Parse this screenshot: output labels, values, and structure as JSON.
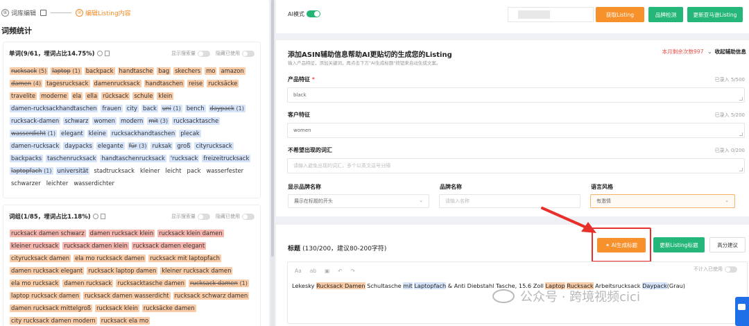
{
  "steps": {
    "step1_num": "①",
    "step1": "词库编辑",
    "step2_num": "②",
    "step2": "编辑Listing内容"
  },
  "section_title": "词频统计",
  "words_card": {
    "title": "单词(9/61，埋词占比14.75%)",
    "opt_search": "显示搜索量",
    "opt_hide": "隐藏已使用",
    "tags": [
      {
        "w": "rucksack",
        "c": "(5)",
        "t": "o",
        "s": true
      },
      {
        "w": "laptop",
        "c": "(1)",
        "t": "o",
        "s": true
      },
      {
        "w": "backpack",
        "c": "",
        "t": "o",
        "s": false
      },
      {
        "w": "handtasche",
        "c": "",
        "t": "o",
        "s": false
      },
      {
        "w": "bag",
        "c": "",
        "t": "o",
        "s": false
      },
      {
        "w": "skechers",
        "c": "",
        "t": "o",
        "s": false
      },
      {
        "w": "mo",
        "c": "",
        "t": "o",
        "s": false
      },
      {
        "w": "amazon",
        "c": "",
        "t": "o",
        "s": false
      },
      {
        "w": "damen",
        "c": "(4)",
        "t": "o",
        "s": true
      },
      {
        "w": "tagesrucksack",
        "c": "",
        "t": "o",
        "s": false
      },
      {
        "w": "damenrucksack",
        "c": "",
        "t": "o",
        "s": false
      },
      {
        "w": "handtaschen",
        "c": "",
        "t": "o",
        "s": false
      },
      {
        "w": "reise",
        "c": "",
        "t": "o",
        "s": false
      },
      {
        "w": "rucksäcke",
        "c": "",
        "t": "o",
        "s": false
      },
      {
        "w": "travelite",
        "c": "",
        "t": "o",
        "s": false
      },
      {
        "w": "moderne",
        "c": "",
        "t": "o",
        "s": false
      },
      {
        "w": "ela",
        "c": "",
        "t": "o",
        "s": false
      },
      {
        "w": "ella",
        "c": "",
        "t": "o",
        "s": false
      },
      {
        "w": "rücksack",
        "c": "",
        "t": "o",
        "s": false
      },
      {
        "w": "schule",
        "c": "",
        "t": "o",
        "s": false
      },
      {
        "w": "klein",
        "c": "",
        "t": "o",
        "s": false
      },
      {
        "w": "damen-rucksackhandtaschen",
        "c": "",
        "t": "b",
        "s": false
      },
      {
        "w": "frauen",
        "c": "",
        "t": "b",
        "s": false
      },
      {
        "w": "city",
        "c": "",
        "t": "b",
        "s": false
      },
      {
        "w": "back",
        "c": "",
        "t": "b",
        "s": false
      },
      {
        "w": "uni",
        "c": "(1)",
        "t": "b",
        "s": true
      },
      {
        "w": "bench",
        "c": "",
        "t": "b",
        "s": false
      },
      {
        "w": "daypack",
        "c": "(1)",
        "t": "b",
        "s": true
      },
      {
        "w": "rucksack-damen",
        "c": "",
        "t": "b",
        "s": false
      },
      {
        "w": "schwarz",
        "c": "",
        "t": "b",
        "s": false
      },
      {
        "w": "women",
        "c": "",
        "t": "b",
        "s": false
      },
      {
        "w": "modern",
        "c": "",
        "t": "b",
        "s": false
      },
      {
        "w": "mit",
        "c": "(3)",
        "t": "b",
        "s": true
      },
      {
        "w": "rucksacktasche",
        "c": "",
        "t": "b",
        "s": false
      },
      {
        "w": "wasserdicht",
        "c": "(1)",
        "t": "b",
        "s": true
      },
      {
        "w": "elegant",
        "c": "",
        "t": "b",
        "s": false
      },
      {
        "w": "kleine",
        "c": "",
        "t": "b",
        "s": false
      },
      {
        "w": "rucksackhandtaschen",
        "c": "",
        "t": "b",
        "s": false
      },
      {
        "w": "plecak",
        "c": "",
        "t": "b",
        "s": false
      },
      {
        "w": "damen-rucksack",
        "c": "",
        "t": "b",
        "s": false
      },
      {
        "w": "daypacks",
        "c": "",
        "t": "b",
        "s": false
      },
      {
        "w": "elegante",
        "c": "",
        "t": "b",
        "s": false
      },
      {
        "w": "für",
        "c": "(3)",
        "t": "b",
        "s": true
      },
      {
        "w": "ruksak",
        "c": "",
        "t": "b",
        "s": false
      },
      {
        "w": "groß",
        "c": "",
        "t": "b",
        "s": false
      },
      {
        "w": "cityrucksack",
        "c": "",
        "t": "b",
        "s": false
      },
      {
        "w": "backpacks",
        "c": "",
        "t": "b",
        "s": false
      },
      {
        "w": "taschenrucksack",
        "c": "",
        "t": "b",
        "s": false
      },
      {
        "w": "handtaschenrucksack",
        "c": "",
        "t": "b",
        "s": false
      },
      {
        "w": "'rucksack",
        "c": "",
        "t": "b",
        "s": false
      },
      {
        "w": "freizeitrucksack",
        "c": "",
        "t": "b",
        "s": false
      },
      {
        "w": "laptopfach",
        "c": "(1)",
        "t": "b",
        "s": true
      },
      {
        "w": "universität",
        "c": "",
        "t": "b",
        "s": false
      },
      {
        "w": "stadtrucksack",
        "c": "",
        "t": "n",
        "s": false
      },
      {
        "w": "kleiner",
        "c": "",
        "t": "n",
        "s": false
      },
      {
        "w": "leicht",
        "c": "",
        "t": "n",
        "s": false
      },
      {
        "w": "pack",
        "c": "",
        "t": "n",
        "s": false
      },
      {
        "w": "wasserfester",
        "c": "",
        "t": "n",
        "s": false
      },
      {
        "w": "schwarzer",
        "c": "",
        "t": "n",
        "s": false
      },
      {
        "w": "leichter",
        "c": "",
        "t": "n",
        "s": false
      },
      {
        "w": "wasserdichter",
        "c": "",
        "t": "n",
        "s": false
      }
    ]
  },
  "phrases_card": {
    "title": "词组(1/85，埋词占比1.18%)",
    "opt_search": "显示搜索量",
    "opt_hide": "隐藏已使用",
    "tags": [
      {
        "w": "rucksack damen schwarz",
        "c": "",
        "t": "r",
        "s": false
      },
      {
        "w": "damen rucksack klein",
        "c": "",
        "t": "r",
        "s": false
      },
      {
        "w": "rucksack klein damen",
        "c": "",
        "t": "r",
        "s": false
      },
      {
        "w": "kleiner rucksack",
        "c": "",
        "t": "r",
        "s": false
      },
      {
        "w": "rucksack damen klein",
        "c": "",
        "t": "r",
        "s": false
      },
      {
        "w": "rucksack damen elegant",
        "c": "",
        "t": "r",
        "s": false
      },
      {
        "w": "cityrucksack damen",
        "c": "",
        "t": "o",
        "s": false
      },
      {
        "w": "ela mo rucksack damen",
        "c": "",
        "t": "o",
        "s": false
      },
      {
        "w": "rucksack mit laptopfach",
        "c": "",
        "t": "o",
        "s": false
      },
      {
        "w": "damen rucksack elegant",
        "c": "",
        "t": "o",
        "s": false
      },
      {
        "w": "rucksack laptop damen",
        "c": "",
        "t": "o",
        "s": false
      },
      {
        "w": "kleiner rucksack damen",
        "c": "",
        "t": "o",
        "s": false
      },
      {
        "w": "ela mo rucksack",
        "c": "",
        "t": "o",
        "s": false
      },
      {
        "w": "damen rucksack",
        "c": "",
        "t": "o",
        "s": false
      },
      {
        "w": "rucksacktasche damen",
        "c": "",
        "t": "o",
        "s": false
      },
      {
        "w": "rucksack damen",
        "c": "(1)",
        "t": "o",
        "s": true
      },
      {
        "w": "laptop rucksack damen",
        "c": "",
        "t": "o",
        "s": false
      },
      {
        "w": "rucksack damen wasserdicht",
        "c": "",
        "t": "o",
        "s": false
      },
      {
        "w": "rucksack schwarz damen",
        "c": "",
        "t": "o",
        "s": false
      },
      {
        "w": "damen rucksack mittelgroß",
        "c": "",
        "t": "o",
        "s": false
      },
      {
        "w": "rucksack klein",
        "c": "",
        "t": "o",
        "s": false
      },
      {
        "w": "rucksäcke damen",
        "c": "",
        "t": "o",
        "s": false
      },
      {
        "w": "city rucksack damen modern",
        "c": "",
        "t": "o",
        "s": false
      },
      {
        "w": "rucksack ela mo",
        "c": "",
        "t": "o",
        "s": false
      }
    ]
  },
  "toolbar": {
    "ai_mode": "AI模式",
    "get_listing": "获取Listing",
    "brand_check": "品牌检测",
    "update_amazon": "更新亚马逊Listing"
  },
  "form": {
    "title": "添加ASIN辅助信息帮助AI更贴切的生成您的Listing",
    "subtitle": "输入产品特征，添加关键词，再点击下方\"AI生成标题\"按钮来自动生成文案。",
    "remaining": "本月剩余次数997",
    "collapse": "收起辅助信息",
    "product_label": "产品特征",
    "product_req": "*",
    "product_count": "已录入 5/500",
    "product_value": "black",
    "customer_label": "客户特征",
    "customer_count": "已录入 5/200",
    "customer_value": "women",
    "avoid_label": "不希望出现的词汇",
    "avoid_count": "已录入 0/200",
    "avoid_placeholder": "请输入避免出现的词汇，多个以英文逗号分隔",
    "brand_display_label": "显示品牌名称",
    "brand_display_value": "展示在标题的开头",
    "brand_name_label": "品牌名称",
    "brand_name_placeholder": "请输入名称",
    "style_label": "语言风格",
    "style_value": "有激情"
  },
  "title_section": {
    "label": "标题",
    "count": "(130/200，建议80-200字符)",
    "ai_btn": "AI生成标题",
    "update_btn": "更新Listing标题",
    "advice_btn": "高分建议",
    "tool_aa": "Aa",
    "tool_ab": "ab",
    "exclude": "不计入已使用",
    "text_parts": [
      {
        "t": "Lekesky ",
        "h": ""
      },
      {
        "t": "Rucksack Damen",
        "h": "o"
      },
      {
        "t": " Schultasche ",
        "h": ""
      },
      {
        "t": "mit",
        "h": "b"
      },
      {
        "t": " ",
        "h": ""
      },
      {
        "t": "Laptopfach",
        "h": "b"
      },
      {
        "t": " & Anti Diebstahl Tasche, 15.6 Zoll ",
        "h": ""
      },
      {
        "t": "Laptop",
        "h": "o"
      },
      {
        "t": " ",
        "h": ""
      },
      {
        "t": "Rucksack",
        "h": "o"
      },
      {
        "t": " Arbeitsrucksack ",
        "h": ""
      },
      {
        "t": "Daypack",
        "h": "b"
      },
      {
        "t": "(Grau)",
        "h": ""
      }
    ]
  },
  "watermark": "公众号 · 跨境视频cici",
  "colors": {
    "accent_orange": "#f7912c",
    "accent_green": "#25b779",
    "highlight_red": "#e8302a"
  },
  "icons": [
    "edit-icon",
    "info-icon",
    "copy-icon",
    "chevron-down-icon",
    "lightbulb-icon",
    "undo-icon",
    "redo-icon",
    "wechat-icon",
    "chat-icon",
    "arrow-pointer"
  ]
}
